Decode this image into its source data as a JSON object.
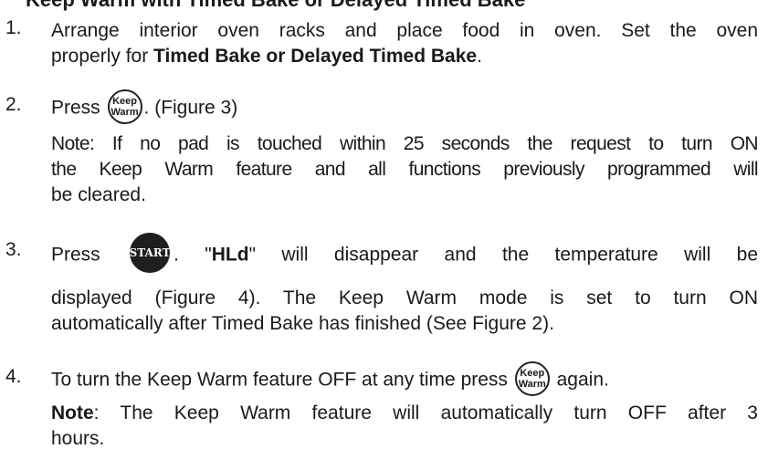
{
  "clipped_heading": "Keep Warm with Timed Bake or Delayed Timed Bake",
  "steps": [
    {
      "num": "1.",
      "line1": "Arrange interior oven racks and place food in oven. Set the oven",
      "line2_pre": "properly for ",
      "line2_bold": "Timed Bake or Delayed Timed Bake",
      "line2_post": "."
    },
    {
      "num": "2.",
      "press": "Press",
      "after_pad": ". (Figure 3)",
      "note1": "Note: If no pad is touched within 25 seconds the request to turn ON",
      "note2": "the Keep Warm feature and all functions previously programmed will",
      "note3": "be cleared."
    },
    {
      "num": "3.",
      "press": "Press",
      "after_a": ". \"",
      "bold": "HLd",
      "after_b": "\" will disappear and the temperature will be",
      "line2": "displayed (Figure 4). The Keep Warm mode is set to turn ON",
      "line3": "automatically after Timed Bake has finished (See Figure 2)."
    },
    {
      "num": "4.",
      "pre_pad": "To turn the Keep Warm feature OFF at any time press",
      "post_pad": "again.",
      "note_bold": "Note",
      "note_rest": ": The Keep Warm feature will automatically turn OFF after 3",
      "note_line2": "hours."
    }
  ],
  "pads": {
    "keep_warm_top": "Keep",
    "keep_warm_bottom": "Warm",
    "start": "START"
  }
}
